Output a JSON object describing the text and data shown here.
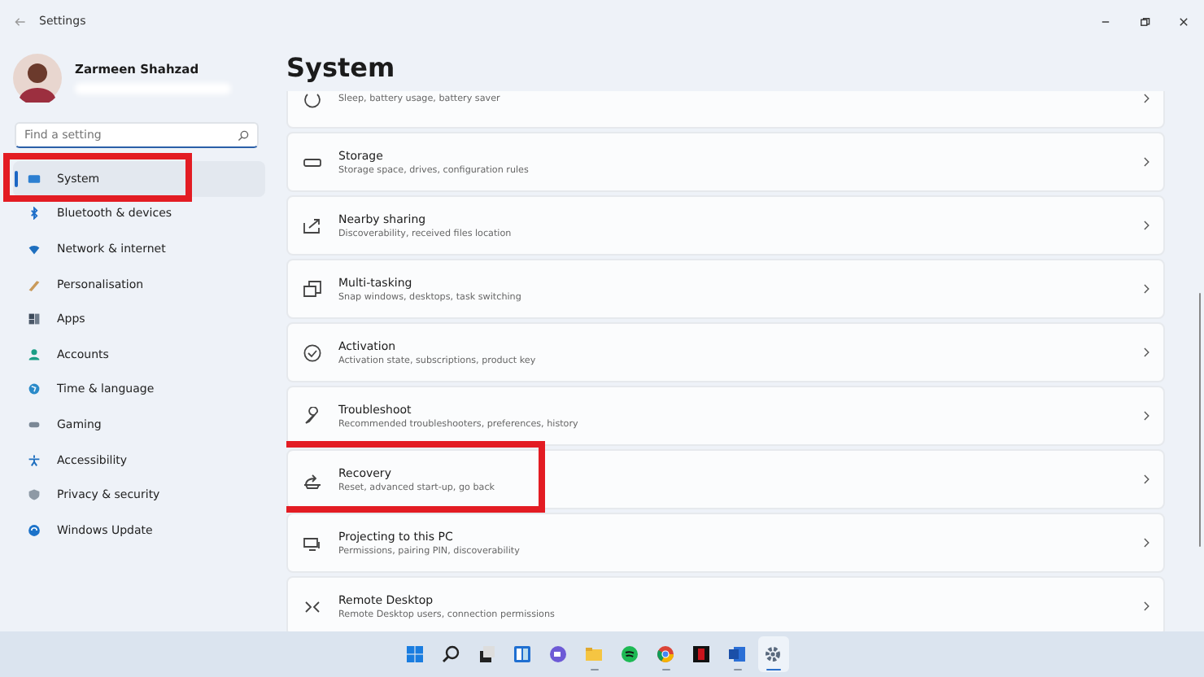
{
  "window": {
    "title": "Settings"
  },
  "user": {
    "name": "Zarmeen Shahzad"
  },
  "search": {
    "placeholder": "Find a setting"
  },
  "nav": [
    {
      "label": "System",
      "selected": true,
      "highlighted": true
    },
    {
      "label": "Bluetooth & devices",
      "selected": false,
      "highlighted": false
    },
    {
      "label": "Network & internet",
      "selected": false,
      "highlighted": false
    },
    {
      "label": "Personalisation",
      "selected": false,
      "highlighted": false
    },
    {
      "label": "Apps",
      "selected": false,
      "highlighted": false
    },
    {
      "label": "Accounts",
      "selected": false,
      "highlighted": false
    },
    {
      "label": "Time & language",
      "selected": false,
      "highlighted": false
    },
    {
      "label": "Gaming",
      "selected": false,
      "highlighted": false
    },
    {
      "label": "Accessibility",
      "selected": false,
      "highlighted": false
    },
    {
      "label": "Privacy & security",
      "selected": false,
      "highlighted": false
    },
    {
      "label": "Windows Update",
      "selected": false,
      "highlighted": false
    }
  ],
  "page_title": "System",
  "cards": [
    {
      "subtitle": "Sleep, battery usage, battery saver",
      "highlighted": false
    },
    {
      "title": "Storage",
      "subtitle": "Storage space, drives, configuration rules",
      "highlighted": false
    },
    {
      "title": "Nearby sharing",
      "subtitle": "Discoverability, received files location",
      "highlighted": false
    },
    {
      "title": "Multi-tasking",
      "subtitle": "Snap windows, desktops, task switching",
      "highlighted": false
    },
    {
      "title": "Activation",
      "subtitle": "Activation state, subscriptions, product key",
      "highlighted": false
    },
    {
      "title": "Troubleshoot",
      "subtitle": "Recommended troubleshooters, preferences, history",
      "highlighted": false
    },
    {
      "title": "Recovery",
      "subtitle": "Reset, advanced start-up, go back",
      "highlighted": true
    },
    {
      "title": "Projecting to this PC",
      "subtitle": "Permissions, pairing PIN, discoverability",
      "highlighted": false
    },
    {
      "title": "Remote Desktop",
      "subtitle": "Remote Desktop users, connection permissions",
      "highlighted": false
    }
  ],
  "taskbar": [
    {
      "running": false,
      "selected": false
    },
    {
      "running": false,
      "selected": false
    },
    {
      "running": false,
      "selected": false
    },
    {
      "running": false,
      "selected": false
    },
    {
      "running": false,
      "selected": false
    },
    {
      "running": true,
      "selected": false
    },
    {
      "running": false,
      "selected": false
    },
    {
      "running": true,
      "selected": false
    },
    {
      "running": false,
      "selected": false
    },
    {
      "running": true,
      "selected": false
    },
    {
      "running": true,
      "selected": true
    }
  ]
}
